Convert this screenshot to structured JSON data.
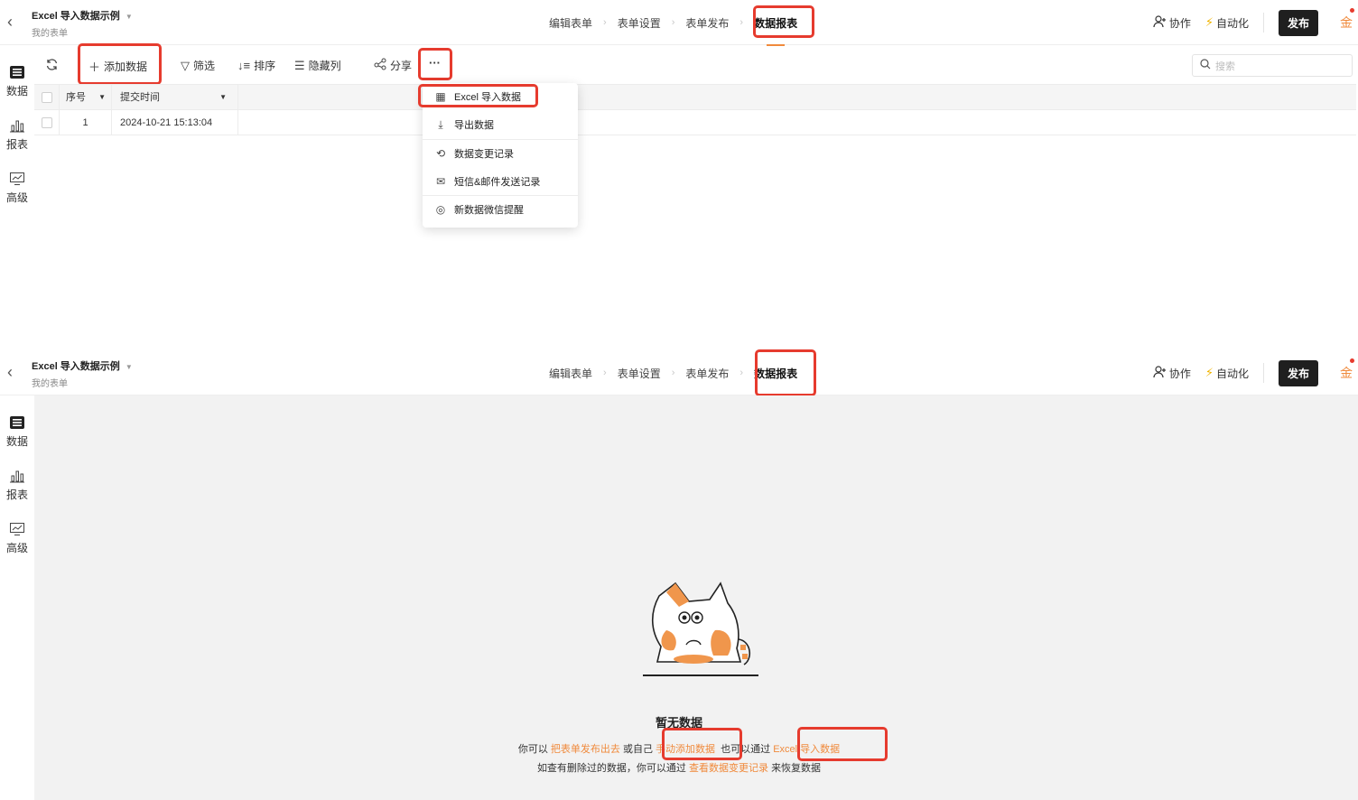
{
  "app": {
    "form_title": "Excel 导入数据示例",
    "form_subtitle": "我的表单",
    "steps": [
      "编辑表单",
      "表单设置",
      "表单发布",
      "数据报表"
    ],
    "collaborate": "协作",
    "automation": "自动化",
    "publish": "发布",
    "coin": "金"
  },
  "sidenav": [
    {
      "label": "数据",
      "icon": "list-icon"
    },
    {
      "label": "报表",
      "icon": "bar-chart-icon"
    },
    {
      "label": "高级",
      "icon": "monitor-chart-icon"
    }
  ],
  "toolbar": {
    "add_data": "添加数据",
    "filter": "筛选",
    "sort": "排序",
    "hide_columns": "隐藏列",
    "share": "分享",
    "more": "···",
    "search_placeholder": "搜索"
  },
  "table": {
    "columns": [
      "序号",
      "提交时间"
    ],
    "rows": [
      {
        "index": "1",
        "submitted": "2024-10-21 15:13:04"
      }
    ]
  },
  "more_menu": [
    {
      "label": "Excel 导入数据",
      "icon": "excel-icon"
    },
    {
      "label": "导出数据",
      "icon": "download-icon"
    },
    {
      "label": "数据变更记录",
      "icon": "history-icon"
    },
    {
      "label": "短信&邮件发送记录",
      "icon": "mail-icon"
    },
    {
      "label": "新数据微信提醒",
      "icon": "wechat-icon"
    }
  ],
  "empty_state": {
    "title": "暂无数据",
    "line1_a": "你可以",
    "link_publish": "把表单发布出去",
    "line1_b": "或自己",
    "link_manual": "手动添加数据",
    "line1_c": "也可以通过",
    "link_excel": "Excel 导入数据",
    "line2_a": "如查有删除过的数据，你可以通过",
    "link_history": "查看数据变更记录",
    "line2_b": "来恢复数据"
  },
  "colors": {
    "accent": "#f08a3c",
    "highlight": "#e63b2e",
    "dark": "#1f1f1f"
  }
}
